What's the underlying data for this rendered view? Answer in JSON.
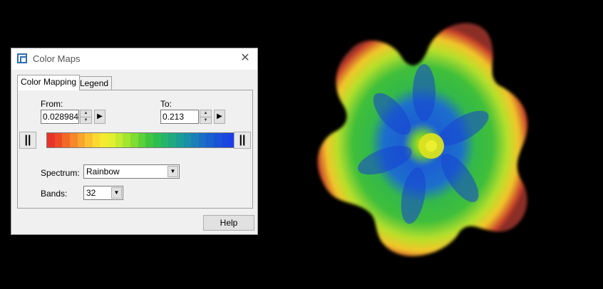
{
  "dialog": {
    "title": "Color Maps",
    "close_glyph": "✕",
    "tabs": [
      {
        "label": "Color Mapping",
        "active": true
      },
      {
        "label": "Legend",
        "active": false
      }
    ],
    "from": {
      "label": "From:",
      "value": "0.028984"
    },
    "to": {
      "label": "To:",
      "value": "0.213"
    },
    "spectrum": {
      "label": "Spectrum:",
      "value": "Rainbow"
    },
    "bands": {
      "label": "Bands:",
      "value": "32"
    },
    "help_label": "Help",
    "slider_glyph": "||",
    "play_glyph": "▶",
    "spin_up": "▲",
    "spin_down": "▼",
    "dropdown_glyph": "▼"
  },
  "spectrum_colors": [
    "#e8332b",
    "#ee4a2a",
    "#f26a27",
    "#f6872a",
    "#f9a52d",
    "#fbc12f",
    "#fcd930",
    "#f5ea2f",
    "#e1ef2f",
    "#c3eb2f",
    "#a3e52f",
    "#7fdc32",
    "#5cd138",
    "#3fc53f",
    "#2ebd52",
    "#25b46a",
    "#1ea981",
    "#1b9d96",
    "#1a8fa8",
    "#1a80b7",
    "#1a6fc4",
    "#1a60cf",
    "#1b53d8",
    "#1c47df",
    "#1d3de4"
  ],
  "visual_icons": {
    "app": "app-window-icon",
    "close": "close-icon"
  }
}
